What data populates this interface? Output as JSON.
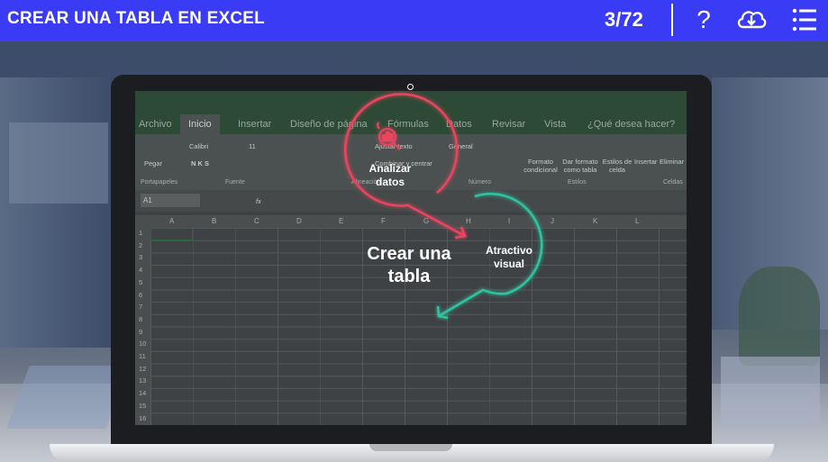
{
  "header": {
    "title": "CREAR UNA TABLA EN EXCEL",
    "progress": "3/72",
    "help_icon": "question-icon",
    "download_icon": "cloud-download-icon",
    "menu_icon": "menu-list-icon"
  },
  "excel": {
    "tabs": [
      "Archivo",
      "Inicio",
      "Insertar",
      "Diseño de página",
      "Fórmulas",
      "Datos",
      "Revisar",
      "Vista",
      "¿Qué desea hacer?"
    ],
    "active_tab": "Inicio",
    "ribbon": {
      "paste": "Pegar",
      "font_name": "Calibri",
      "font_size": "11",
      "bold_italic_underline": "N K S",
      "number_format": "General",
      "conditional_format": "Formato condicional",
      "format_as_table": "Dar formato como tabla",
      "cell_styles": "Estilos de celda",
      "insert": "Insertar",
      "delete": "Eliminar",
      "groups": [
        "Portapapeles",
        "Fuente",
        "Alineación",
        "Número",
        "Estilos",
        "Celdas"
      ],
      "wrap_text": "Ajustar texto",
      "merge_center": "Combinar y centrar"
    },
    "name_box": "A1",
    "fx": "fx",
    "columns": [
      "A",
      "B",
      "C",
      "D",
      "E",
      "F",
      "G",
      "H",
      "I",
      "J",
      "K",
      "L"
    ],
    "rows": [
      "1",
      "2",
      "3",
      "4",
      "5",
      "6",
      "7",
      "8",
      "9",
      "10",
      "11",
      "12",
      "13",
      "14",
      "15",
      "16"
    ]
  },
  "diagram": {
    "center_label": "Crear una tabla",
    "node1_label": "Analizar datos",
    "node1_icon": "magnifier-chart-icon",
    "node2_label": "Atractivo visual",
    "colors": {
      "analizar": "#e8455e",
      "atractivo": "#2ec4a0",
      "header": "#3a3bf5"
    }
  }
}
